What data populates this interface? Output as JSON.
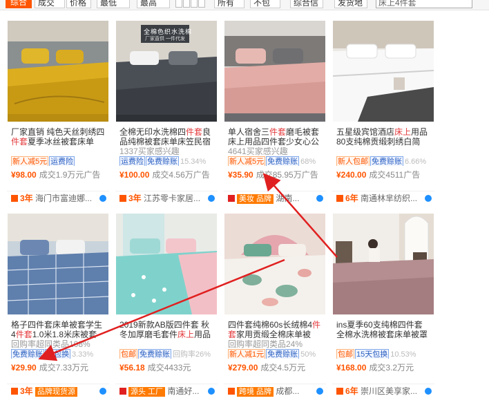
{
  "filterbar": {
    "tabs": [
      "综合",
      "成交额",
      "价格"
    ],
    "ranges": [
      "最低",
      "最高"
    ],
    "selects": [
      "所有地",
      "不包",
      "综合信",
      "发货地"
    ],
    "search_value": "床上4件套"
  },
  "products": [
    {
      "title_a": "厂家直销 纯色天丝刺绣四",
      "title_hl": "件套",
      "title_b": "夏季冰丝被套床单",
      "sub": "",
      "badges": [
        {
          "t": "新人减5元",
          "c": "orange"
        },
        {
          "t": "运费险",
          "c": "blue"
        }
      ],
      "price": "¥98.00",
      "sold": "成交1.9万元广告",
      "shop_years": "3年",
      "shop_name": "海门市富迪娜...",
      "shop_tag": ""
    },
    {
      "title_a": "全棉无印水洗棉四",
      "title_hl": "件套",
      "title_b": "良品纯棉被套床单床笠民宿",
      "sub": "1337买家感兴趣",
      "badges": [
        {
          "t": "运费险",
          "c": "blue"
        },
        {
          "t": "免费赊账",
          "c": "blue"
        },
        {
          "t": "15.34%",
          "c": "gray"
        }
      ],
      "price": "¥100.00",
      "sold": "成交4.56万广告",
      "shop_years": "3年",
      "shop_name": "江苏零卡家居...",
      "shop_tag": ""
    },
    {
      "title_a": "单人宿舍三",
      "title_hl": "件套",
      "title_b": "磨毛被套床上用品四件套少女心公",
      "sub": "4641买家感兴趣",
      "badges": [
        {
          "t": "新人减5元",
          "c": "orange"
        },
        {
          "t": "免费赊账",
          "c": "blue"
        },
        {
          "t": "68%",
          "c": "gray"
        }
      ],
      "price": "¥35.90",
      "sold": "成交85.95万广告",
      "shop_years": "",
      "shop_name": "湖南...",
      "shop_tag": "美妆 品牌"
    },
    {
      "title_a": "五星级宾馆酒店",
      "title_hl": "床上",
      "title_b": "用品80支纯棉贡缎刺绣白简",
      "sub": "",
      "badges": [
        {
          "t": "新人包邮",
          "c": "orange"
        },
        {
          "t": "免费赊账",
          "c": "blue"
        },
        {
          "t": "6.66%",
          "c": "gray"
        }
      ],
      "price": "¥240.00",
      "sold": "成交4511广告",
      "shop_years": "6年",
      "shop_name": "南通林芈纺织...",
      "shop_tag": ""
    },
    {
      "title_a": "格子四件套床单被套学生4",
      "title_hl": "件套",
      "title_b": "1.0米1.8米床被套",
      "sub": "回购率超同类品108%",
      "badges": [
        {
          "t": "免费赊账",
          "c": "blue"
        },
        {
          "t": "天包换",
          "c": "blue"
        },
        {
          "t": "3.33%",
          "c": "gray"
        }
      ],
      "price": "¥29.90",
      "sold": "成交7.33万元",
      "shop_years": "3年",
      "shop_name": "",
      "shop_tag": "品牌现货源"
    },
    {
      "title_a": "2019新款AB版四件套 秋冬加厚磨毛套件",
      "title_hl": "床上",
      "title_b": "用品",
      "sub": "",
      "badges": [
        {
          "t": "包邮",
          "c": "orange"
        },
        {
          "t": "免费赊账",
          "c": "blue"
        },
        {
          "t": "回购率26%",
          "c": "gray"
        }
      ],
      "price": "¥56.18",
      "sold": "成交4433元",
      "shop_years": "",
      "shop_name": "南通好...",
      "shop_tag": "源头 工厂"
    },
    {
      "title_a": "四件套纯棉60s长绒棉4",
      "title_hl": "件套",
      "title_b": "家用贡缎全棉床单被",
      "sub": "回购率超同类品24%",
      "badges": [
        {
          "t": "新人减1元",
          "c": "orange"
        },
        {
          "t": "免费赊账",
          "c": "blue"
        },
        {
          "t": "50%",
          "c": "gray"
        }
      ],
      "price": "¥279.00",
      "sold": "成交4.5万元",
      "shop_years": "",
      "shop_name": "成都...",
      "shop_tag": "跨境 品牌"
    },
    {
      "title_a": "ins夏季60支纯棉四件套全棉水洗棉被套床单被罩",
      "title_hl": "",
      "title_b": "",
      "sub": "",
      "badges": [
        {
          "t": "包邮",
          "c": "orange"
        },
        {
          "t": "15天包换",
          "c": "blue"
        },
        {
          "t": "10.53%",
          "c": "gray"
        }
      ],
      "price": "¥168.00",
      "sold": "成交3.2万元",
      "shop_years": "6年",
      "shop_name": "崇川区美享家...",
      "shop_tag": ""
    }
  ],
  "image_banner": {
    "line1": "全棉色织水洗棉",
    "line2": "厂家直供 一件代发"
  },
  "colors": {
    "accent": "#ff5500",
    "arrow": "#e02020",
    "link_blue": "#2a5fc1"
  }
}
